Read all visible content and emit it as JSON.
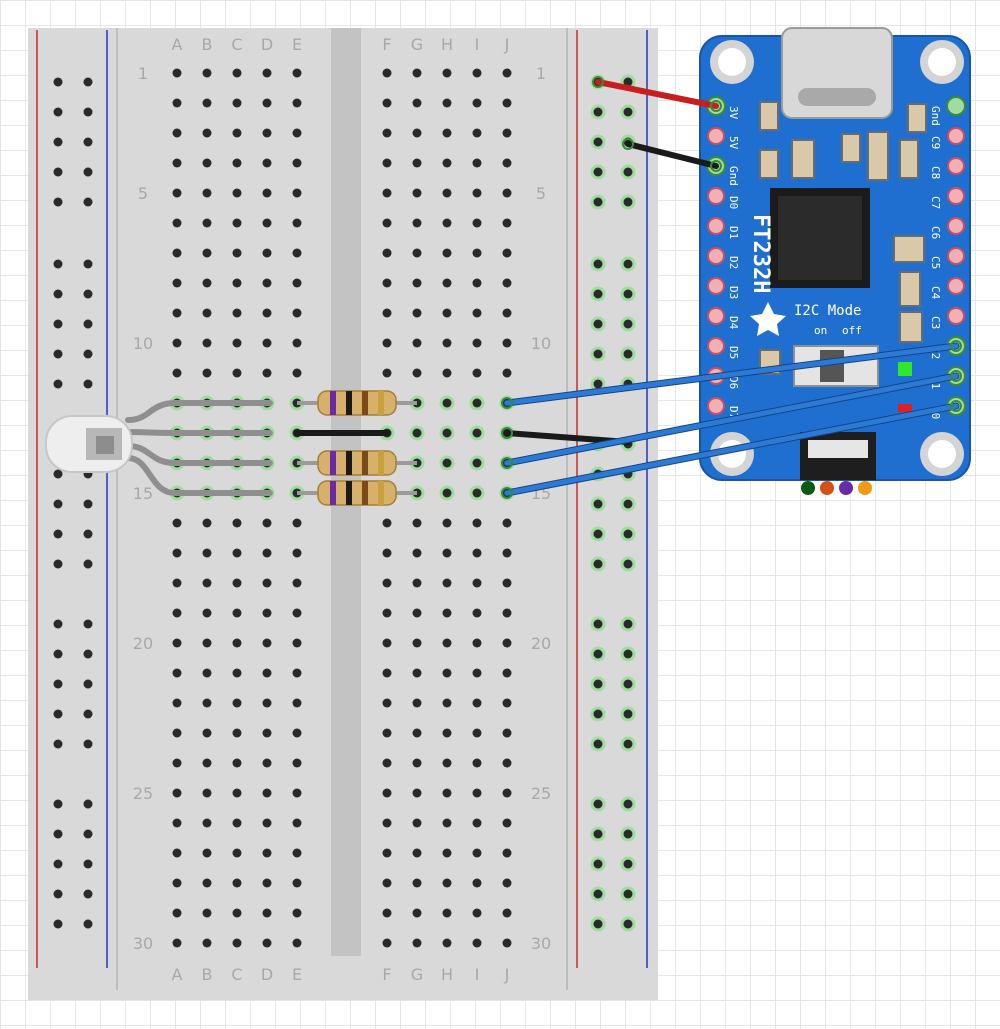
{
  "breadboard": {
    "column_letters_left": [
      "A",
      "B",
      "C",
      "D",
      "E"
    ],
    "column_letters_right": [
      "F",
      "G",
      "H",
      "I",
      "J"
    ],
    "row_labels": [
      "1",
      "5",
      "10",
      "15",
      "20",
      "25",
      "30"
    ],
    "row_count": 30
  },
  "board": {
    "title": "FT232H",
    "mode_label": "I2C Mode",
    "switch_on_label": "on",
    "switch_off_label": "off",
    "left_pins": [
      "3V",
      "5V",
      "Gnd",
      "D0",
      "D1",
      "D2",
      "D3",
      "D4",
      "D5",
      "D6",
      "D7"
    ],
    "right_pins": [
      "Gnd",
      "C9",
      "C8",
      "C7",
      "C6",
      "C5",
      "C4",
      "C3",
      "C2",
      "C1",
      "C0"
    ],
    "pcb_color": "#1f6fd1",
    "led_colors": [
      "#0a5a12",
      "#d64f17",
      "#6a2aa8",
      "#f29a13"
    ]
  },
  "wires": [
    {
      "name": "power-3v",
      "color": "#c81e1e"
    },
    {
      "name": "ground",
      "color": "#1a1a1a"
    },
    {
      "name": "signal",
      "color": "#2d7ad6"
    },
    {
      "name": "led-lead",
      "color": "#8f8f8f"
    }
  ],
  "components": {
    "led": {
      "type": "rgb-led"
    },
    "resistors": {
      "count": 3,
      "bands": [
        "#6a2aa8",
        "#1a1a1a",
        "#7a4a1a",
        "#c9a13a"
      ]
    }
  }
}
